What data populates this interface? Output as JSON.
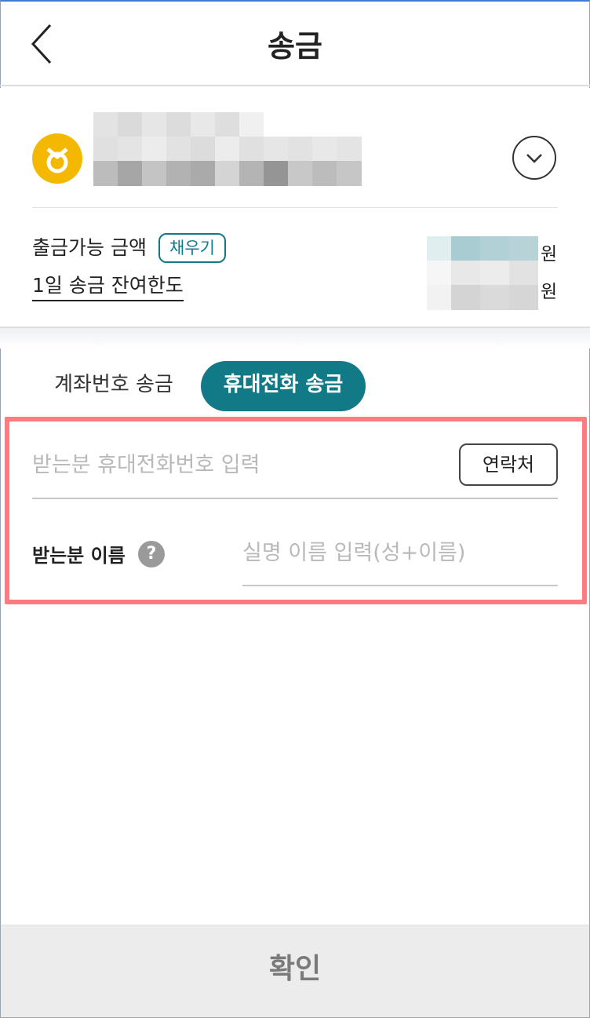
{
  "header": {
    "title": "송금",
    "back_icon": "chevron-left-icon"
  },
  "account": {
    "bank_logo_icon": "bank-logo-icon",
    "bank_logo_color": "#f5b800",
    "dropdown_icon": "chevron-down-icon",
    "available_label": "출금가능 금액",
    "fill_label": "채우기",
    "daily_limit_label": "1일 송금 잔여한도",
    "currency_unit": "원",
    "balance_hidden": true
  },
  "tabs": [
    {
      "label": "계좌번호 송금",
      "active": false
    },
    {
      "label": "휴대전화 송금",
      "active": true
    }
  ],
  "form": {
    "phone_placeholder": "받는분 휴대전화번호 입력",
    "phone_value": "",
    "contacts_label": "연락처",
    "name_label": "받는분 이름",
    "help_icon": "?",
    "name_placeholder": "실명 이름 입력(성+이름)",
    "name_value": ""
  },
  "confirm_label": "확인",
  "colors": {
    "accent": "#127a86",
    "highlight": "#ff7b80",
    "disabled_button": "#ececec"
  }
}
